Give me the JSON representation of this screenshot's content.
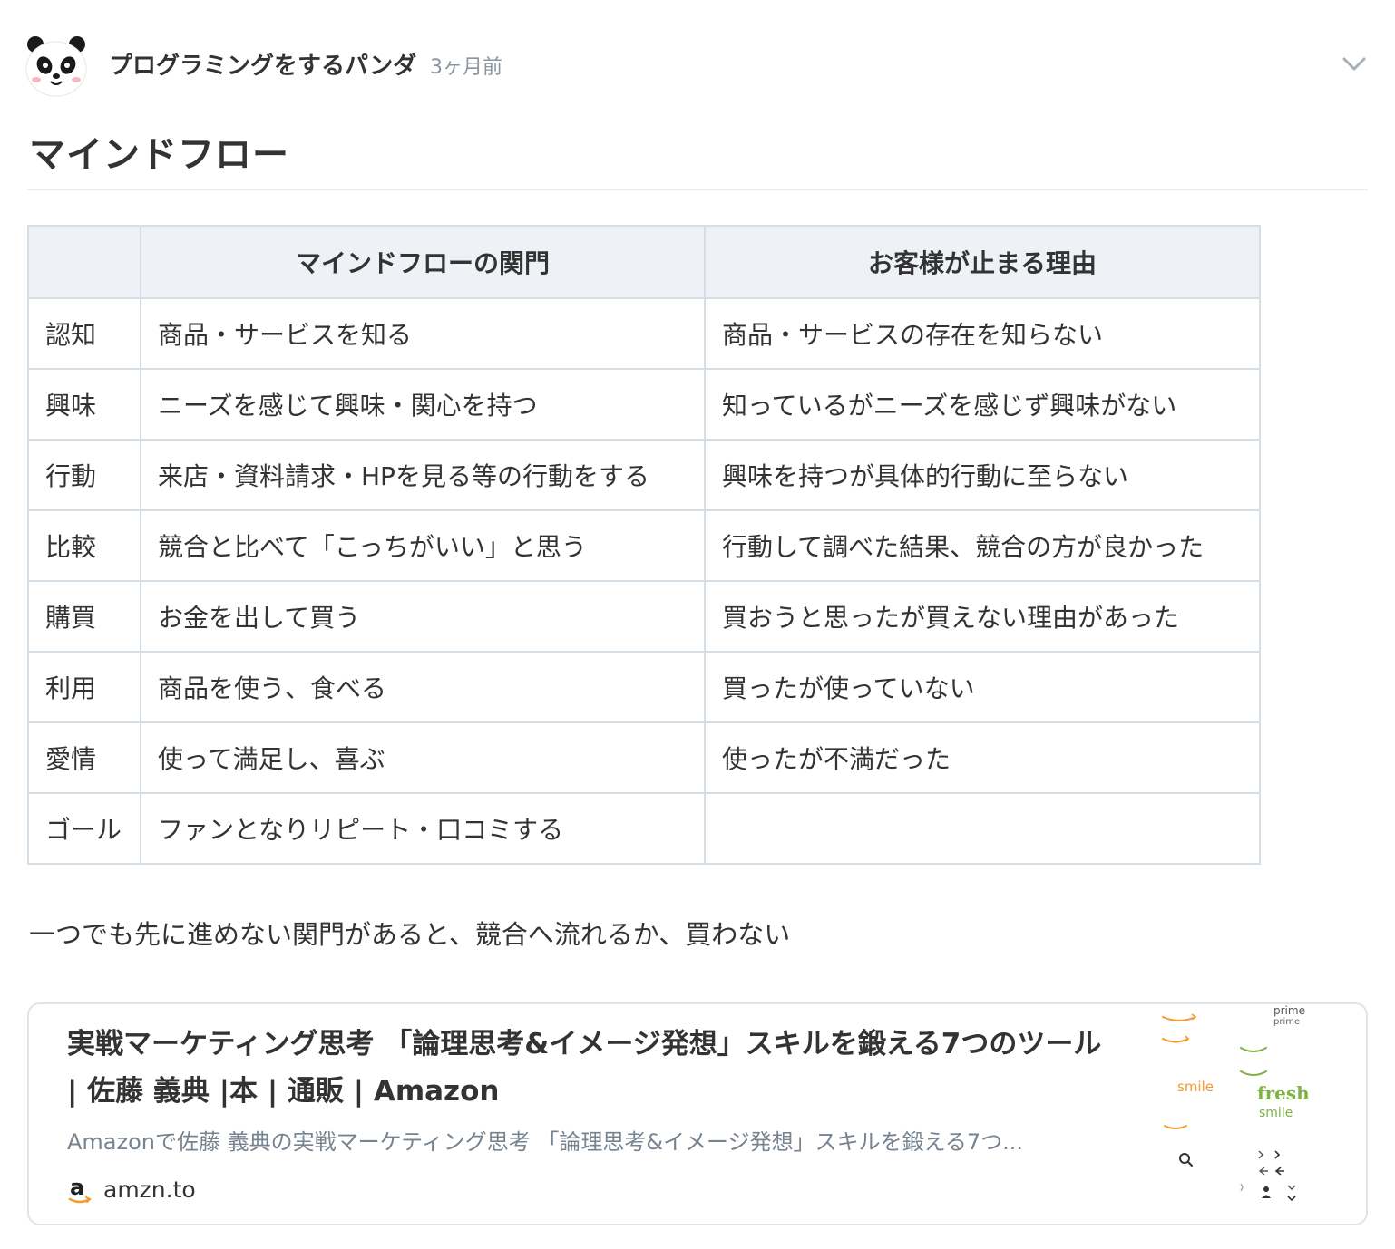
{
  "header": {
    "author_name": "プログラミングをするパンダ",
    "post_time": "3ヶ月前"
  },
  "post": {
    "title": "マインドフロー",
    "table": {
      "headers": [
        "",
        "マインドフローの関門",
        "お客様が止まる理由"
      ],
      "rows": [
        [
          "認知",
          "商品・サービスを知る",
          "商品・サービスの存在を知らない"
        ],
        [
          "興味",
          "ニーズを感じて興味・関心を持つ",
          "知っているがニーズを感じず興味がない"
        ],
        [
          "行動",
          "来店・資料請求・HPを見る等の行動をする",
          "興味を持つが具体的行動に至らない"
        ],
        [
          "比較",
          "競合と比べて「こっちがいい」と思う",
          "行動して調べた結果、競合の方が良かった"
        ],
        [
          "購買",
          "お金を出して買う",
          "買おうと思ったが買えない理由があった"
        ],
        [
          "利用",
          "商品を使う、食べる",
          "買ったが使っていない"
        ],
        [
          "愛情",
          "使って満足し、喜ぶ",
          "使ったが不満だった"
        ],
        [
          "ゴール",
          "ファンとなりリピート・口コミする",
          ""
        ]
      ]
    },
    "conclusion": "一つでも先に進めない関門があると、競合へ流れるか、買わない"
  },
  "link_card": {
    "title": "実戦マーケティング思考 「論理思考&イメージ発想」スキルを鍛える7つのツール | 佐藤 義典 |本 | 通販 | Amazon",
    "description": "Amazonで佐藤 義典の実戦マーケティング思考 「論理思考&イメージ発想」スキルを鍛える7つ...",
    "domain": "amzn.to",
    "favicon_letter": "a",
    "thumbnail": {
      "prime": "prime",
      "prime_small": "prime",
      "smile": "smile",
      "fresh": "fresh",
      "fresh_smile": "smile"
    }
  },
  "colors": {
    "text": "#333333",
    "muted": "#8a95a0",
    "table_header_bg": "#eef2f6",
    "border": "#d6dee5",
    "amazon_orange": "#f59a2b",
    "fresh_green": "#7cb342"
  },
  "icons": {
    "avatar": "panda-avatar-icon",
    "menu": "chevron-down-icon",
    "favicon": "amazon-favicon-icon"
  }
}
